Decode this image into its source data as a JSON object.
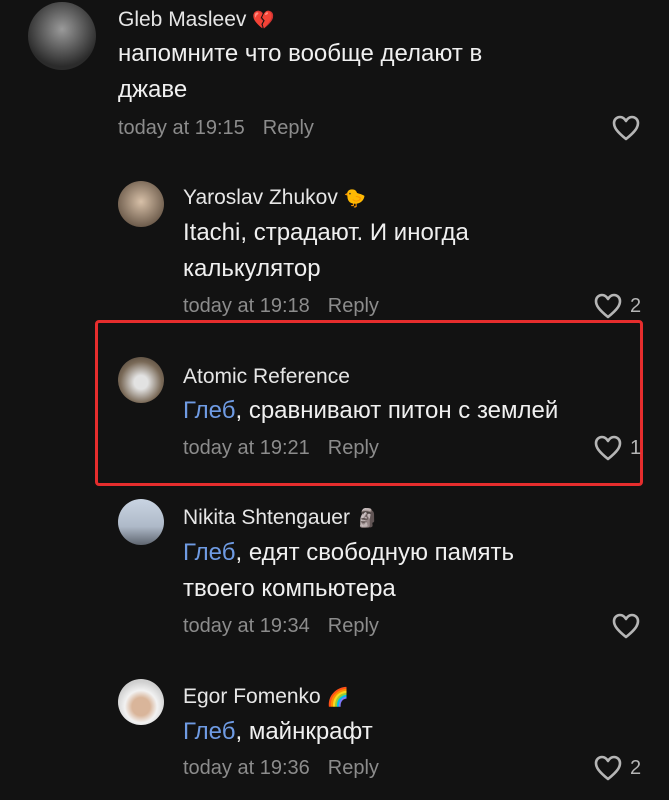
{
  "comments": [
    {
      "author": "Gleb Masleev",
      "emoji": "💔",
      "mention": "",
      "text_line1": "напомните что вообще делают в",
      "text_line2": "джаве",
      "time": "today at 19:15",
      "reply": "Reply",
      "likes": ""
    },
    {
      "author": "Yaroslav Zhukov",
      "emoji": "🐤",
      "mention": "",
      "text_line1": "Itachi, страдают. И иногда",
      "text_line2": "калькулятор",
      "time": "today at 19:18",
      "reply": "Reply",
      "likes": "2"
    },
    {
      "author": "Atomic Reference",
      "emoji": "",
      "mention": "Глеб",
      "text_line1": ", сравнивают питон с землей",
      "text_line2": "",
      "time": "today at 19:21",
      "reply": "Reply",
      "likes": "1"
    },
    {
      "author": "Nikita Shtengauer",
      "emoji": "🗿",
      "mention": "Глеб",
      "text_line1": ", едят свободную память",
      "text_line2": "твоего компьютера",
      "time": "today at 19:34",
      "reply": "Reply",
      "likes": ""
    },
    {
      "author": "Egor Fomenko",
      "emoji": "🌈",
      "mention": "Глеб",
      "text_line1": ", майнкрафт",
      "text_line2": "",
      "time": "today at 19:36",
      "reply": "Reply",
      "likes": "2"
    }
  ],
  "colors": {
    "background": "#121212",
    "mention": "#6f9be3",
    "highlight_border": "#e52d2d",
    "meta": "#8c8c8c"
  }
}
